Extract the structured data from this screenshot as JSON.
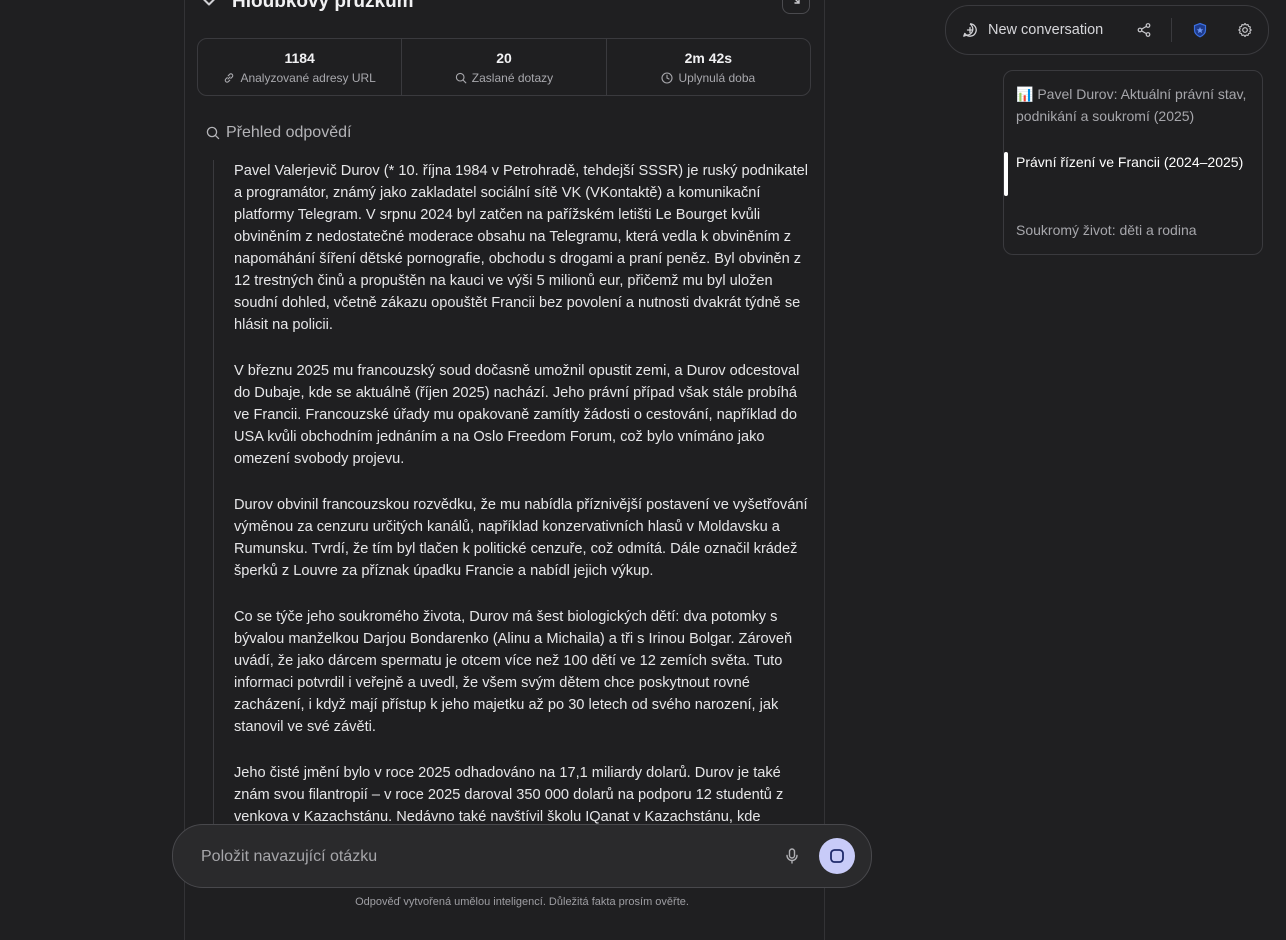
{
  "header": {
    "title": "Hloubkový průzkum"
  },
  "stats": [
    {
      "value": "1184",
      "label": "Analyzované adresy URL",
      "icon": "link-icon"
    },
    {
      "value": "20",
      "label": "Zaslané dotazy",
      "icon": "search-icon"
    },
    {
      "value": "2m 42s",
      "label": "Uplynulá doba",
      "icon": "clock-icon"
    }
  ],
  "overview": {
    "label": "Přehled odpovědí"
  },
  "content": {
    "paragraphs": [
      "Pavel Valerjevič Durov (* 10. října 1984 v Petrohradě, tehdejší SSSR) je ruský podnikatel a programátor, známý jako zakladatel sociální sítě VK (VKontaktě) a komunikační platformy Telegram. V srpnu 2024 byl zatčen na pařížském letišti Le Bourget kvůli obviněním z nedostatečné moderace obsahu na Telegramu, která vedla k obviněním z napomáhání šíření dětské pornografie, obchodu s drogami a praní peněz. Byl obviněn z 12 trestných činů a propuštěn na kauci ve výši 5 milionů eur, přičemž mu byl uložen soudní dohled, včetně zákazu opouštět Francii bez povolení a nutnosti dvakrát týdně se hlásit na policii.",
      "V březnu 2025 mu francouzský soud dočasně umožnil opustit zemi, a Durov odcestoval do Dubaje, kde se aktuálně (říjen 2025) nachází. Jeho právní případ však stále probíhá ve Francii. Francouzské úřady mu opakovaně zamítly žádosti o cestování, například do USA kvůli obchodním jednáním a na Oslo Freedom Forum, což bylo vnímáno jako omezení svobody projevu.",
      "Durov obvinil francouzskou rozvědku, že mu nabídla příznivější postavení ve vyšetřování výměnou za cenzuru určitých kanálů, například konzervativních hlasů v Moldavsku a Rumunsku. Tvrdí, že tím byl tlačen k politické cenzuře, což odmítá. Dále označil krádež šperků z Louvre za příznak úpadku Francie a nabídl jejich výkup.",
      "Co se týče jeho soukromého života, Durov má šest biologických dětí: dva potomky s bývalou manželkou Darjou Bondarenko (Alinu a Michaila) a tři s Irinou Bolgar. Zároveň uvádí, že jako dárcem spermatu je otcem více než 100 dětí ve 12 zemích světa. Tuto informaci potvrdil i veřejně a uvedl, že všem svým dětem chce poskytnout rovné zacházení, i když mají přístup k jeho majetku až po 30 letech od svého narození, jak stanovil ve své závěti.",
      "Jeho čisté jmění bylo v roce 2025 odhadováno na 17,1 miliardy dolarů. Durov je také znám svou filantropií – v roce 2025 daroval 350 000 dolarů na podporu 12 studentů z venkova v Kazachstánu. Nedávno také navštívil školu IQanat v Kazachstánu, kde"
    ]
  },
  "input": {
    "placeholder": "Položit navazující otázku"
  },
  "footer": {
    "text": "Odpověď vytvořená umělou inteligencí. Důležitá fakta prosím ověřte."
  },
  "topbar": {
    "new_conversation": "New conversation"
  },
  "toc": {
    "items": [
      {
        "label": "📊 Pavel Durov: Aktuální právní stav, podnikání a soukromí (2025)",
        "active": false
      },
      {
        "label": "Právní řízení ve Francii (2024–2025)",
        "active": true
      },
      {
        "label": "Soukromý život: děti a rodina",
        "active": false
      }
    ]
  },
  "colors": {
    "background": "#1f1f21",
    "accent_button": "#c8cbf8",
    "shield": "#3b6fe0"
  }
}
